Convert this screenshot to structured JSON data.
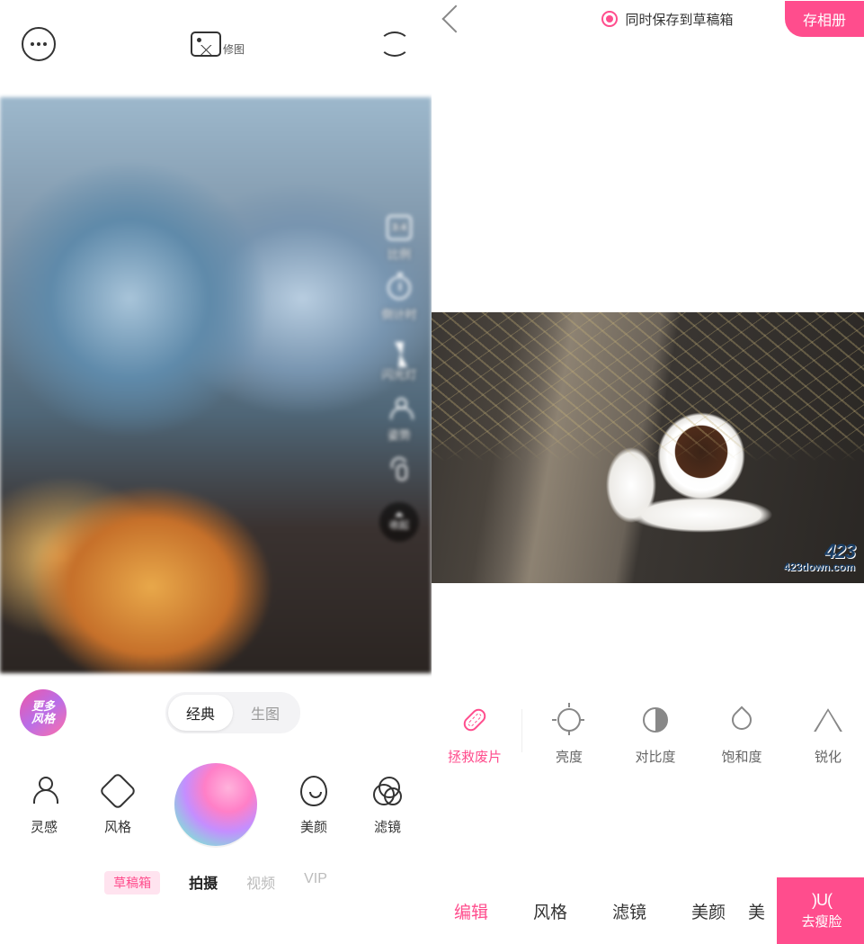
{
  "left": {
    "topbar": {
      "edit_label": "修图"
    },
    "side_tools": {
      "ratio": {
        "value": "3:4",
        "label": "比例"
      },
      "timer": {
        "label": "倒计时"
      },
      "flash": {
        "label": "闪光灯"
      },
      "pose": {
        "label": "姿势"
      },
      "touch": {
        "label": ""
      },
      "fold": {
        "label": "收起"
      }
    },
    "more_styles_badge": "更多\n风格",
    "segment": {
      "classic": "经典",
      "raw": "生图",
      "active": "classic"
    },
    "tools": {
      "inspiration": "灵感",
      "style": "风格",
      "beauty": "美颜",
      "filter": "滤镜"
    },
    "modes": {
      "draft": "草稿箱",
      "shoot": "拍摄",
      "video": "视频",
      "vip": "VIP",
      "active": "shoot"
    }
  },
  "right": {
    "topbar": {
      "save_draft_label": "同时保存到草稿箱",
      "save_button": "存相册"
    },
    "watermark": {
      "line1": "423",
      "line2": "423down.com"
    },
    "adjust_tools": {
      "rescue": "拯救废片",
      "brightness": "亮度",
      "contrast": "对比度",
      "saturation": "饱和度",
      "sharpen": "锐化"
    },
    "tabs": {
      "edit": "编辑",
      "style": "风格",
      "filter": "滤镜",
      "beauty": "美颜",
      "beauty2_partial": "美",
      "active": "edit"
    },
    "face_button": {
      "icon": ")U(",
      "label": "去瘦脸"
    }
  }
}
